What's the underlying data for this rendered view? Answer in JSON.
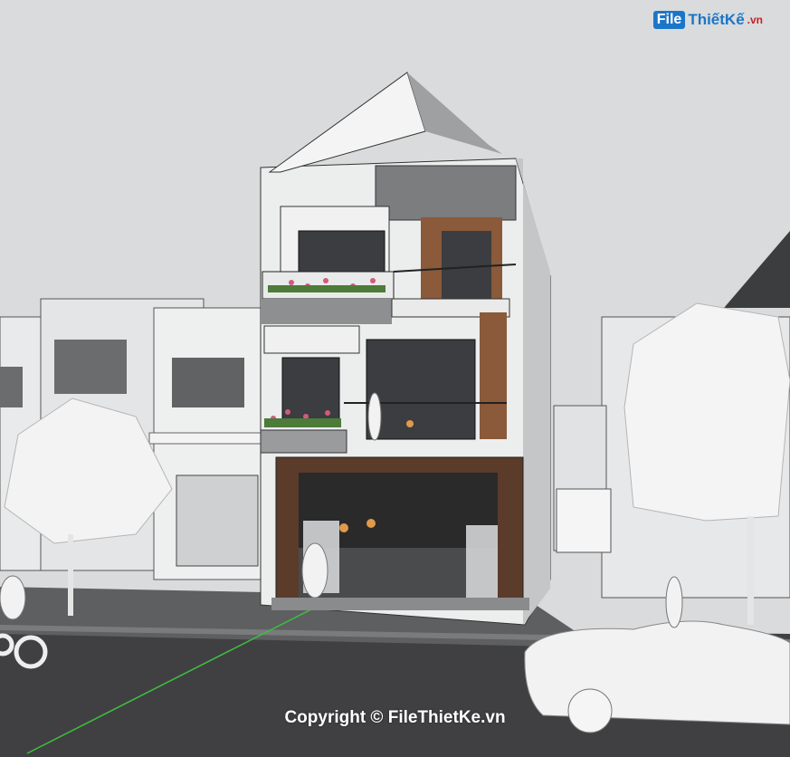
{
  "watermark": {
    "logo_file": "File",
    "logo_brand": "ThiếtKế",
    "logo_tld": ".vn",
    "copyright": "Copyright © FileThietKe.vn"
  },
  "scene": {
    "subject": "3-storey townhouse 3D model",
    "colors": {
      "sky": "#d8d9da",
      "wall": "#ecedef",
      "wall_shadow": "#b9babc",
      "wood": "#8a5a3a",
      "marble": "#5b3b2a",
      "road": "#3e3e40",
      "green_axis": "#3fbf3f"
    }
  }
}
